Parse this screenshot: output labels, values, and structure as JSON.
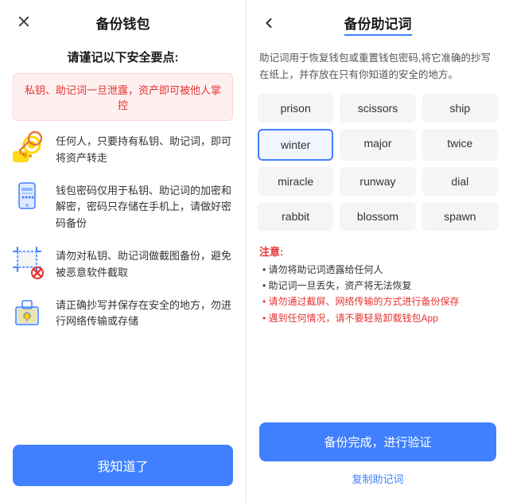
{
  "left": {
    "title": "备份钱包",
    "close_icon": "×",
    "security_heading": "请谨记以下安全要点:",
    "warning": "私钥、助记词一旦泄露，资产即可被他人掌控",
    "items": [
      {
        "icon": "key",
        "text": "任何人，只要持有私钥、助记词，即可将资产转走"
      },
      {
        "icon": "phone",
        "text": "钱包密码仅用于私钥、助记词的加密和解密，密码只存储在手机上，请做好密码备份"
      },
      {
        "icon": "screenshot",
        "text": "请勿对私钥、助记词做截图备份，避免被恶意软件截取"
      },
      {
        "icon": "copy",
        "text": "请正确抄写并保存在安全的地方，勿进行网络传输或存储"
      }
    ],
    "confirm_label": "我知道了"
  },
  "right": {
    "title": "备份助记词",
    "back_icon": "‹",
    "description": "助记词用于恢复钱包或重置钱包密码,将它准确的抄写在纸上，并存放在只有你知道的安全的地方。",
    "words": [
      "prison",
      "scissors",
      "ship",
      "winter",
      "major",
      "twice",
      "miracle",
      "runway",
      "dial",
      "rabbit",
      "blossom",
      "spawn"
    ],
    "highlighted_word": "winter",
    "notes_title": "注意:",
    "notes": [
      {
        "text": "• 请勿将助记词透露给任何人",
        "red": false
      },
      {
        "text": "• 助记词一旦丢失，资产将无法恢复",
        "red": false
      },
      {
        "text": "• 请勿通过截屏、网络传输的方式进行备份保存",
        "red": true
      },
      {
        "text": "• 遇到任何情况，请不要轻易卸载钱包App",
        "red": true
      }
    ],
    "backup_button_label": "备份完成，进行验证",
    "copy_label": "复制助记词"
  }
}
